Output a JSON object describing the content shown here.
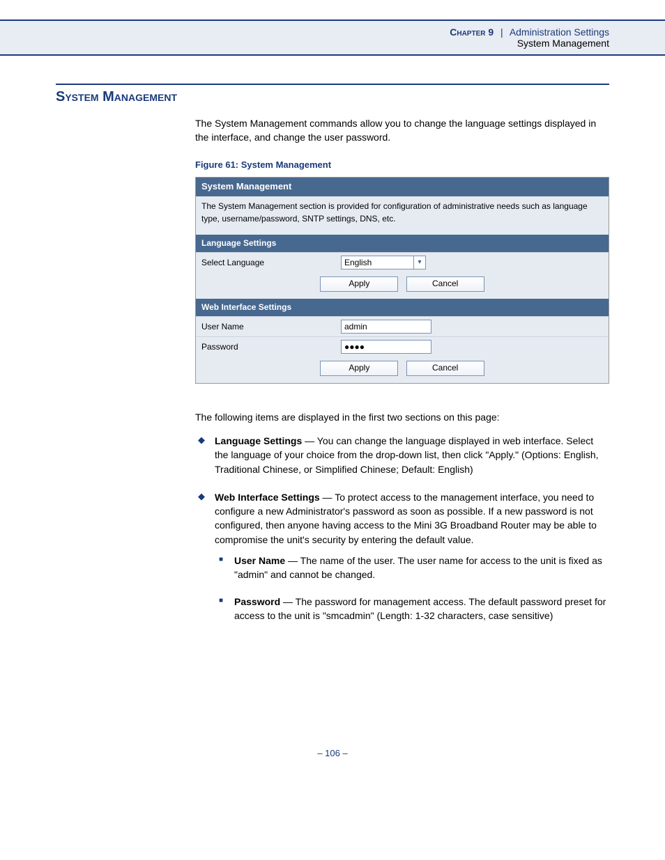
{
  "header": {
    "chapter": "Chapter 9",
    "title": "Administration Settings",
    "subtitle": "System Management"
  },
  "section": {
    "title": "System Management",
    "intro": "The System Management commands allow you to change the language settings displayed in the interface, and change the user password.",
    "figure_caption": "Figure 61:  System Management"
  },
  "figure": {
    "panel_title": "System Management",
    "panel_desc": "The System Management section is provided for configuration of administrative needs such as language type, username/password, SNTP settings, DNS, etc.",
    "lang_header": "Language Settings",
    "lang_label": "Select Language",
    "lang_value": "English",
    "apply": "Apply",
    "cancel": "Cancel",
    "web_header": "Web Interface Settings",
    "user_label": "User Name",
    "user_value": "admin",
    "pass_label": "Password",
    "pass_value": "●●●●"
  },
  "follow_text": "The following items are displayed in the first two sections on this page:",
  "bullets": {
    "lang_title": "Language Settings",
    "lang_text": " — You can change the language displayed in web interface. Select the language of your choice from the drop-down list, then click \"Apply.\" (Options: English, Traditional Chinese, or Simplified Chinese; Default: English)",
    "web_title": "Web Interface Settings",
    "web_text": " — To protect access to the management interface, you need to configure a new Administrator's password as soon as possible. If a new password is not configured, then anyone having access to the Mini 3G Broadband Router may be able to compromise the unit's security by entering the default value.",
    "user_title": "User Name",
    "user_text": " — The name of the user. The user name for access to the unit is fixed as \"admin\" and cannot be changed.",
    "pass_title": "Password",
    "pass_text": " — The password for management access. The default password preset for access to the unit is \"smcadmin\" (Length: 1-32 characters, case sensitive)"
  },
  "footer": {
    "page": "–  106  –"
  }
}
